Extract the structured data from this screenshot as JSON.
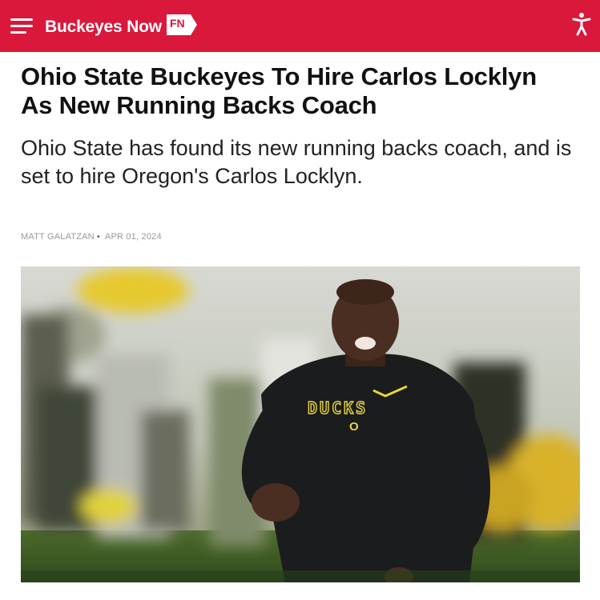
{
  "header": {
    "brand_name": "Buckeyes Now",
    "badge_text": "FN",
    "menu_icon": "hamburger-menu-icon",
    "accessibility_icon": "accessibility-person-icon",
    "bar_color": "#d9183b"
  },
  "article": {
    "headline": "Ohio State Buckeyes To Hire Carlos Locklyn As New Running Backs Coach",
    "dek": "Ohio State has found its new running backs coach, and is set to hire Oregon's Carlos Locklyn.",
    "author": "MATT GALATZAN",
    "separator": "•",
    "date": "APR 01, 2024"
  },
  "hero_image": {
    "shirt_wordmark": "DUCKS",
    "shirt_monogram": "O"
  }
}
